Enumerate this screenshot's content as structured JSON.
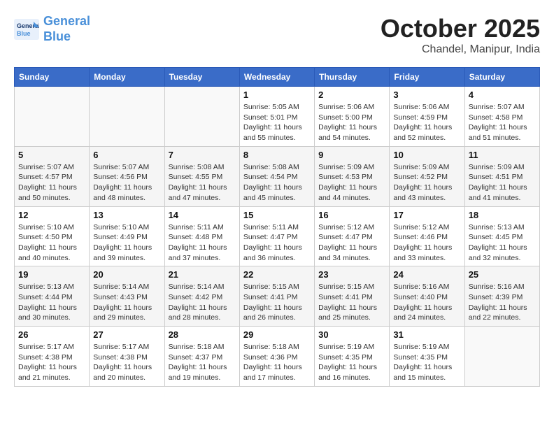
{
  "header": {
    "logo_line1": "General",
    "logo_line2": "Blue",
    "month": "October 2025",
    "location": "Chandel, Manipur, India"
  },
  "weekdays": [
    "Sunday",
    "Monday",
    "Tuesday",
    "Wednesday",
    "Thursday",
    "Friday",
    "Saturday"
  ],
  "weeks": [
    [
      {
        "day": "",
        "info": ""
      },
      {
        "day": "",
        "info": ""
      },
      {
        "day": "",
        "info": ""
      },
      {
        "day": "1",
        "info": "Sunrise: 5:05 AM\nSunset: 5:01 PM\nDaylight: 11 hours\nand 55 minutes."
      },
      {
        "day": "2",
        "info": "Sunrise: 5:06 AM\nSunset: 5:00 PM\nDaylight: 11 hours\nand 54 minutes."
      },
      {
        "day": "3",
        "info": "Sunrise: 5:06 AM\nSunset: 4:59 PM\nDaylight: 11 hours\nand 52 minutes."
      },
      {
        "day": "4",
        "info": "Sunrise: 5:07 AM\nSunset: 4:58 PM\nDaylight: 11 hours\nand 51 minutes."
      }
    ],
    [
      {
        "day": "5",
        "info": "Sunrise: 5:07 AM\nSunset: 4:57 PM\nDaylight: 11 hours\nand 50 minutes."
      },
      {
        "day": "6",
        "info": "Sunrise: 5:07 AM\nSunset: 4:56 PM\nDaylight: 11 hours\nand 48 minutes."
      },
      {
        "day": "7",
        "info": "Sunrise: 5:08 AM\nSunset: 4:55 PM\nDaylight: 11 hours\nand 47 minutes."
      },
      {
        "day": "8",
        "info": "Sunrise: 5:08 AM\nSunset: 4:54 PM\nDaylight: 11 hours\nand 45 minutes."
      },
      {
        "day": "9",
        "info": "Sunrise: 5:09 AM\nSunset: 4:53 PM\nDaylight: 11 hours\nand 44 minutes."
      },
      {
        "day": "10",
        "info": "Sunrise: 5:09 AM\nSunset: 4:52 PM\nDaylight: 11 hours\nand 43 minutes."
      },
      {
        "day": "11",
        "info": "Sunrise: 5:09 AM\nSunset: 4:51 PM\nDaylight: 11 hours\nand 41 minutes."
      }
    ],
    [
      {
        "day": "12",
        "info": "Sunrise: 5:10 AM\nSunset: 4:50 PM\nDaylight: 11 hours\nand 40 minutes."
      },
      {
        "day": "13",
        "info": "Sunrise: 5:10 AM\nSunset: 4:49 PM\nDaylight: 11 hours\nand 39 minutes."
      },
      {
        "day": "14",
        "info": "Sunrise: 5:11 AM\nSunset: 4:48 PM\nDaylight: 11 hours\nand 37 minutes."
      },
      {
        "day": "15",
        "info": "Sunrise: 5:11 AM\nSunset: 4:47 PM\nDaylight: 11 hours\nand 36 minutes."
      },
      {
        "day": "16",
        "info": "Sunrise: 5:12 AM\nSunset: 4:47 PM\nDaylight: 11 hours\nand 34 minutes."
      },
      {
        "day": "17",
        "info": "Sunrise: 5:12 AM\nSunset: 4:46 PM\nDaylight: 11 hours\nand 33 minutes."
      },
      {
        "day": "18",
        "info": "Sunrise: 5:13 AM\nSunset: 4:45 PM\nDaylight: 11 hours\nand 32 minutes."
      }
    ],
    [
      {
        "day": "19",
        "info": "Sunrise: 5:13 AM\nSunset: 4:44 PM\nDaylight: 11 hours\nand 30 minutes."
      },
      {
        "day": "20",
        "info": "Sunrise: 5:14 AM\nSunset: 4:43 PM\nDaylight: 11 hours\nand 29 minutes."
      },
      {
        "day": "21",
        "info": "Sunrise: 5:14 AM\nSunset: 4:42 PM\nDaylight: 11 hours\nand 28 minutes."
      },
      {
        "day": "22",
        "info": "Sunrise: 5:15 AM\nSunset: 4:41 PM\nDaylight: 11 hours\nand 26 minutes."
      },
      {
        "day": "23",
        "info": "Sunrise: 5:15 AM\nSunset: 4:41 PM\nDaylight: 11 hours\nand 25 minutes."
      },
      {
        "day": "24",
        "info": "Sunrise: 5:16 AM\nSunset: 4:40 PM\nDaylight: 11 hours\nand 24 minutes."
      },
      {
        "day": "25",
        "info": "Sunrise: 5:16 AM\nSunset: 4:39 PM\nDaylight: 11 hours\nand 22 minutes."
      }
    ],
    [
      {
        "day": "26",
        "info": "Sunrise: 5:17 AM\nSunset: 4:38 PM\nDaylight: 11 hours\nand 21 minutes."
      },
      {
        "day": "27",
        "info": "Sunrise: 5:17 AM\nSunset: 4:38 PM\nDaylight: 11 hours\nand 20 minutes."
      },
      {
        "day": "28",
        "info": "Sunrise: 5:18 AM\nSunset: 4:37 PM\nDaylight: 11 hours\nand 19 minutes."
      },
      {
        "day": "29",
        "info": "Sunrise: 5:18 AM\nSunset: 4:36 PM\nDaylight: 11 hours\nand 17 minutes."
      },
      {
        "day": "30",
        "info": "Sunrise: 5:19 AM\nSunset: 4:35 PM\nDaylight: 11 hours\nand 16 minutes."
      },
      {
        "day": "31",
        "info": "Sunrise: 5:19 AM\nSunset: 4:35 PM\nDaylight: 11 hours\nand 15 minutes."
      },
      {
        "day": "",
        "info": ""
      }
    ]
  ]
}
